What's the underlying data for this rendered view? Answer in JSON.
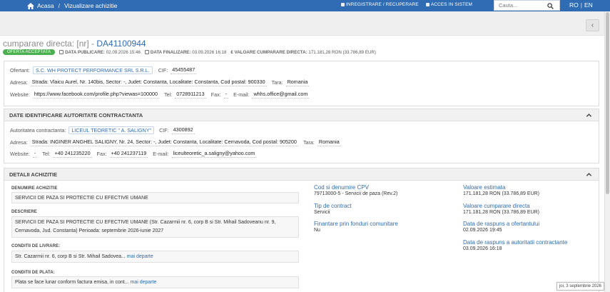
{
  "nav": {
    "home": "Acasa",
    "separator": "/",
    "current": "Vizualizare achizitie",
    "register": "INREGISTRARE / RECUPERARE",
    "login": "ACCES IN SISTEM",
    "search_placeholder": "Cauta...",
    "lang_ro": "RO",
    "lang_sep": "|",
    "lang_en": "EN",
    "brand_color": "#2f6cb3"
  },
  "back_button": "‹",
  "title": {
    "prefix": "cumparare directa: [nr] - ",
    "code": "DA41100944"
  },
  "meta": {
    "status": "OFERTA ACCEPTATA",
    "status_color": "#4caf50",
    "publish_label": "DATA PUBLICARE:",
    "publish_value": "02.09.2026 15:46",
    "final_label": "DATA FINALIZARE:",
    "final_value": "03.09.2026 16:18",
    "value_label": "€ VALOARE CUMPARARE DIRECTA:",
    "value_value": "171.181,28  RON (33.786,89  EUR)"
  },
  "supplier": {
    "ofertant_label": "Ofertant:",
    "ofertant": "S.C. WH PROTECT PERFORMANCE SRL S.R.L.",
    "cif_label": "CIF:",
    "cif": "45455487",
    "adresa_label": "Adresa:",
    "adresa": "Strada: Vlaicu Aurel, Nr. 140bis, Sector: -, Judet: Constanta, Localitate: Constanta, Cod postal: 900330",
    "tara_label": "Tara:",
    "tara": "Romania",
    "website_label": "Website:",
    "website": "https://www.facebook.com/profile.php?viewas=100000",
    "tel_label": "Tel:",
    "tel": "0728911213",
    "fax_label": "Fax:",
    "fax": "-",
    "email_label": "E-mail:",
    "email": "whhs.office@gmail.com"
  },
  "authority": {
    "heading": "DATE IDENTIFICARE AUTORITATE CONTRACTANTA",
    "auth_label": "Autoritatea contractanta:",
    "auth": "LICEUL TEORETIC \" A. SALIGNY\"",
    "cif_label": "CIF:",
    "cif": "4300892",
    "adresa_label": "Adresa:",
    "adresa": "Strada: INGINER ANGHEL SALIGNY, Nr. 24, Sector: -, Judet: Constanta, Localitate: Cernavoda, Cod postal: 905200",
    "tara_label": "Tara:",
    "tara": "Romania",
    "website_label": "Website:",
    "website": "-",
    "tel_label": "Tel:",
    "tel": "+40 241235220",
    "fax_label": "Fax:",
    "fax": "+40 241237119",
    "email_label": "E-mail:",
    "email": "liceulteoretic_a.saligny@yahoo.com"
  },
  "details": {
    "heading": "DETALII ACHIZITIE",
    "denumire_label": "DENUMIRE ACHIZITIE",
    "denumire": "SERVICII DE PAZA SI PROTECTIE CU EFECTIVE UMANE",
    "descriere_label": "DESCRIERE",
    "descriere": "SERVICII DE PAZA SI PROTECTIE CU EFECTIVE UMANE (Str. Cazarmii nr. 6, corp B si Str. Mihail Sadoveanu nr. 9, Cernavoda, Jud. Constanta) Perioada: septembrie 2026-iunie 2027",
    "livrare_label": "CONDITII DE LIVRARE:",
    "livrare": "Str. Cazarmii nr. 6, corp B si Str. Mihail Sadovea...",
    "livrare_more": "mai departe",
    "plata_label": "CONDITII DE PLATA:",
    "plata": "Plata se face lunar conform factura emisa, in cont...",
    "plata_more": "mai departe",
    "cpv_label": "Cod si denumire CPV",
    "cpv": "79713000-5 - Servicii de paza (Rev.2)",
    "tip_label": "Tip de contract",
    "tip": "Servicii",
    "fin_label": "Finantare prin fonduri comunitare",
    "fin": "Nu",
    "estimata_label": "Valoare estimata",
    "estimata": "171.181,28  RON (33.786,89  EUR)",
    "cumparare_label": "Valoare cumparare directa",
    "cumparare": "171.181,28  RON (33.786,89  EUR)",
    "raspuns_of_label": "Data de raspuns a ofertantului",
    "raspuns_of": "02.09.2026 19:45",
    "raspuns_ac_label": "Data de raspuns a autoritatii contractante",
    "raspuns_ac": "03.09.2026 16:18"
  },
  "tooltip": "joi, 3 septembrie 2026"
}
